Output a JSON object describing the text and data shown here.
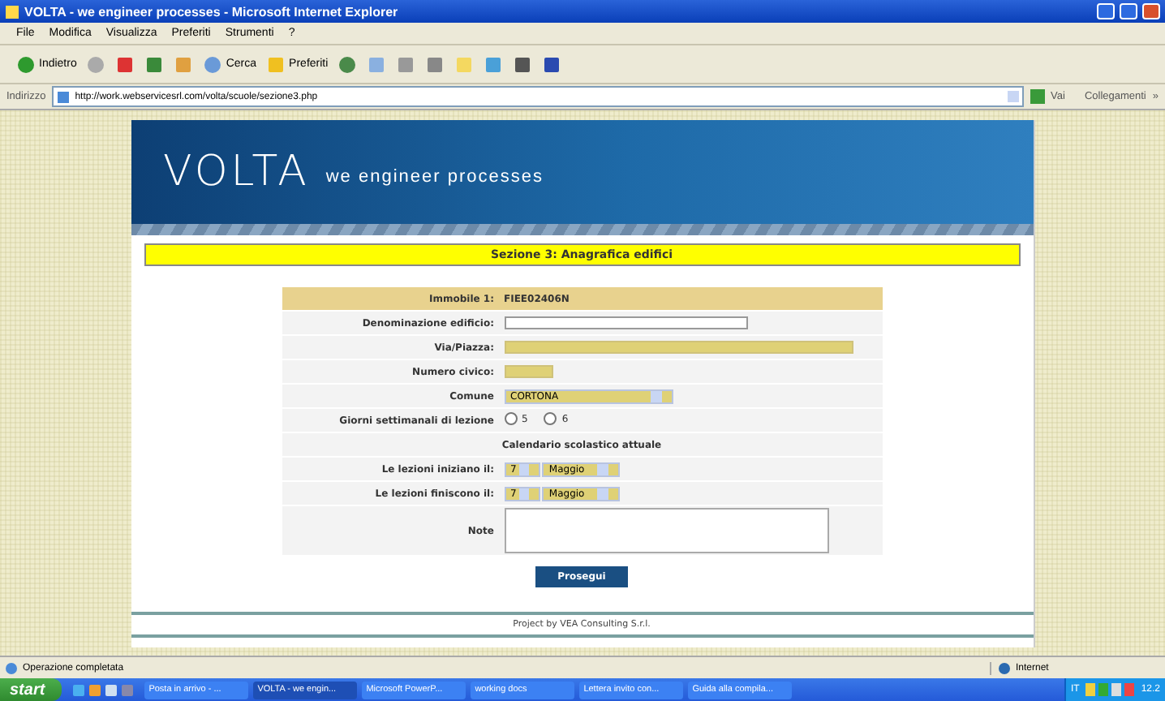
{
  "window": {
    "title": "VOLTA - we engineer processes - Microsoft Internet Explorer"
  },
  "menu": [
    "File",
    "Modifica",
    "Visualizza",
    "Preferiti",
    "Strumenti",
    "?"
  ],
  "toolbar": {
    "back": "Indietro",
    "search": "Cerca",
    "favorites": "Preferiti"
  },
  "address": {
    "label": "Indirizzo",
    "value": "http://work.webservicesrl.com/volta/scuole/sezione3.php",
    "go": "Vai",
    "links": "Collegamenti",
    "more": "»"
  },
  "banner": {
    "logo": "VOLTA",
    "tagline": "we engineer processes"
  },
  "section_title": "Sezione 3: Anagrafica edifici",
  "form": {
    "header": {
      "label": "Immobile 1:",
      "value": "FIEE02406N"
    },
    "rows": [
      {
        "kind": "text",
        "label": "Denominazione edificio:",
        "highlighted": false
      },
      {
        "kind": "text",
        "label": "Via/Piazza:",
        "highlighted": true
      },
      {
        "kind": "text",
        "label": "Numero civico:",
        "highlighted": true
      },
      {
        "kind": "select",
        "label": "Comune",
        "value": "CORTONA"
      },
      {
        "kind": "radio",
        "label": "Giorni settimanali di lezione",
        "options": [
          {
            "label": "5",
            "selected": false
          },
          {
            "label": "6",
            "selected": false
          }
        ]
      },
      {
        "kind": "heading",
        "label": "Calendario scolastico attuale"
      },
      {
        "kind": "date",
        "label": "Le lezioni iniziano il:",
        "day": "7",
        "month": "Maggio"
      },
      {
        "kind": "date",
        "label": "Le lezioni finiscono il:",
        "day": "7",
        "month": "Maggio"
      },
      {
        "kind": "textarea",
        "label": "Note"
      }
    ]
  },
  "submit": "Prosegui",
  "footer": "Project by VEA Consulting S.r.l.",
  "status": {
    "text": "Operazione completata",
    "zone": "Internet"
  },
  "taskbar": {
    "start": "start",
    "tasks": [
      {
        "label": "Posta in arrivo - ...",
        "selected": false
      },
      {
        "label": "VOLTA - we engin...",
        "selected": true
      },
      {
        "label": "Microsoft PowerP...",
        "selected": false
      },
      {
        "label": "working docs",
        "selected": false
      },
      {
        "label": "Lettera invito con...",
        "selected": false
      },
      {
        "label": "Guida alla compila...",
        "selected": false
      }
    ],
    "lang": "IT",
    "clock": "12.2"
  }
}
